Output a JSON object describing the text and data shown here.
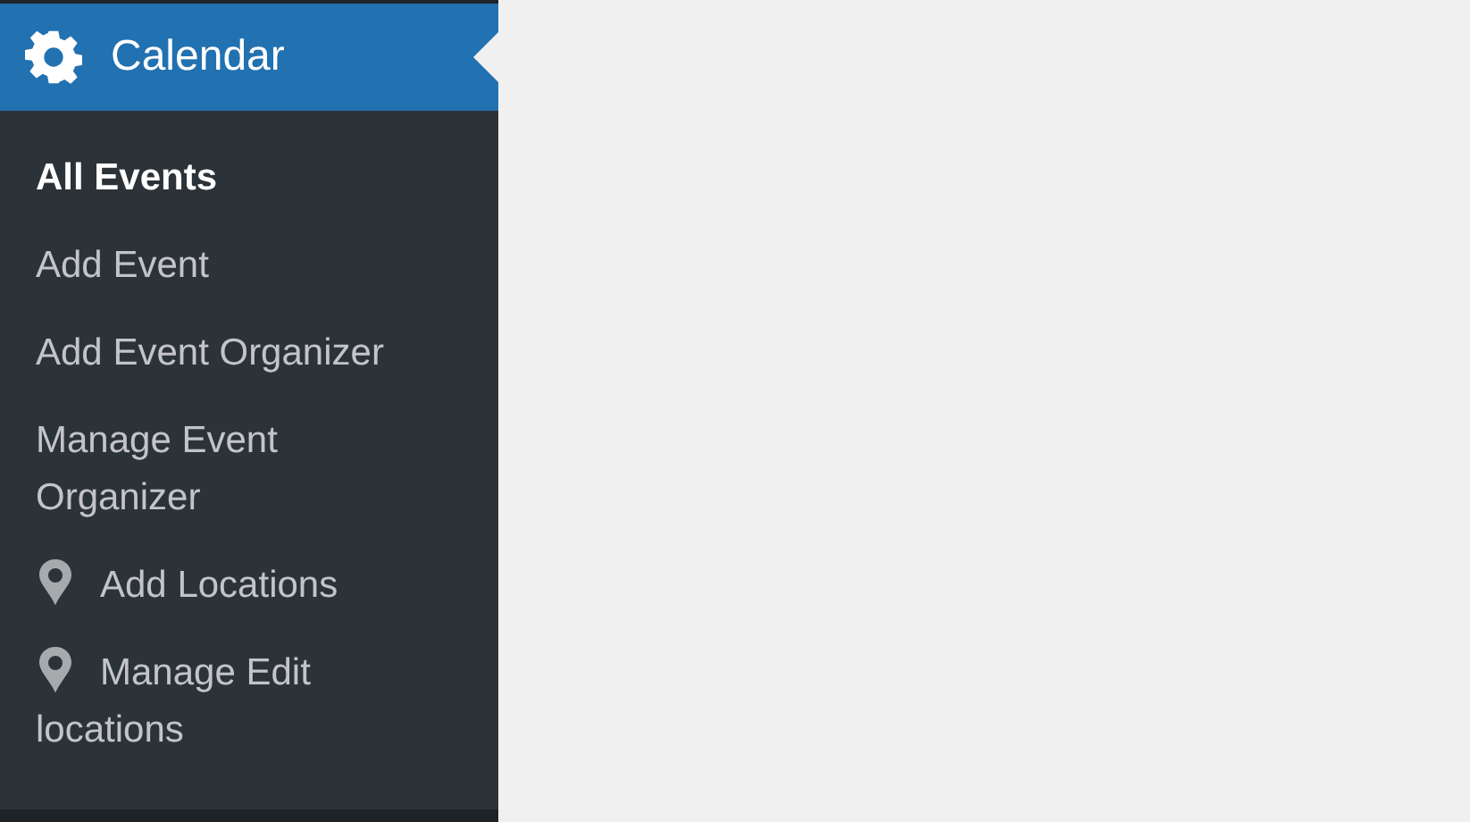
{
  "menu": {
    "title": "Calendar",
    "expanded": true,
    "items": [
      {
        "label": "All Events",
        "kind": "text",
        "selected": true
      },
      {
        "label": "Add Event",
        "kind": "text",
        "selected": false
      },
      {
        "label": "Add Event Organizer",
        "kind": "text",
        "selected": false
      },
      {
        "label": "Manage Event Organizer",
        "kind": "text",
        "selected": false
      },
      {
        "label": "Add Locations",
        "kind": "location",
        "selected": false
      },
      {
        "label": "Manage Edit locations",
        "kind": "location",
        "selected": false
      }
    ]
  }
}
